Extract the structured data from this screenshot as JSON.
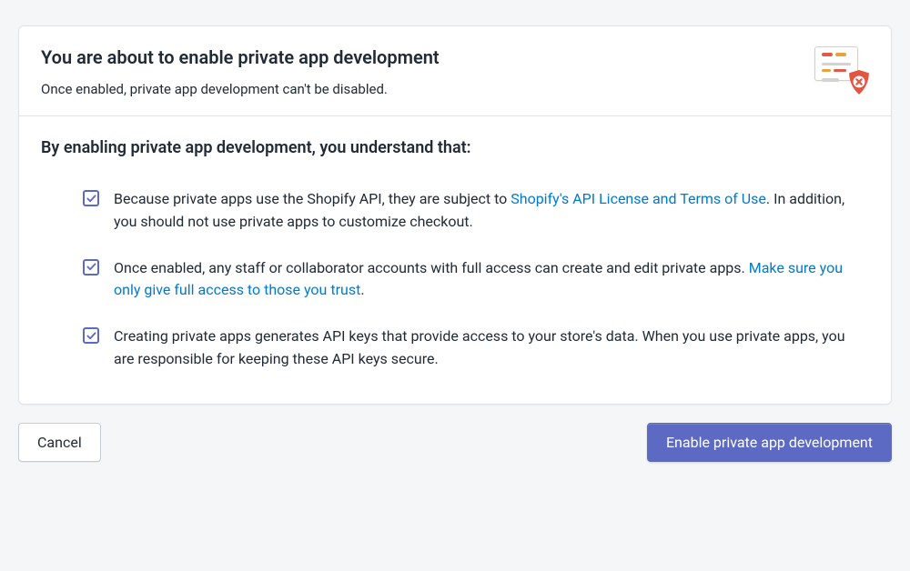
{
  "header": {
    "title": "You are about to enable private app development",
    "subtitle": "Once enabled, private app development can't be disabled."
  },
  "body": {
    "heading": "By enabling private app development, you understand that:",
    "items": [
      {
        "pre": "Because private apps use the Shopify API, they are subject to ",
        "link": "Shopify's API License and Terms of Use",
        "post": ". In addition, you should not use private apps to customize checkout."
      },
      {
        "pre": "Once enabled, any staff or collaborator accounts with full access can create and edit private apps. ",
        "link": "Make sure you only give full access to those you trust",
        "post": "."
      },
      {
        "pre": "Creating private apps generates API keys that provide access to your store's data. When you use private apps, you are responsible for keeping these API keys secure.",
        "link": "",
        "post": ""
      }
    ]
  },
  "actions": {
    "cancel": "Cancel",
    "confirm": "Enable private app development"
  },
  "colors": {
    "accent": "#5c6ac4",
    "link": "#007ace",
    "danger": "#de3618"
  }
}
